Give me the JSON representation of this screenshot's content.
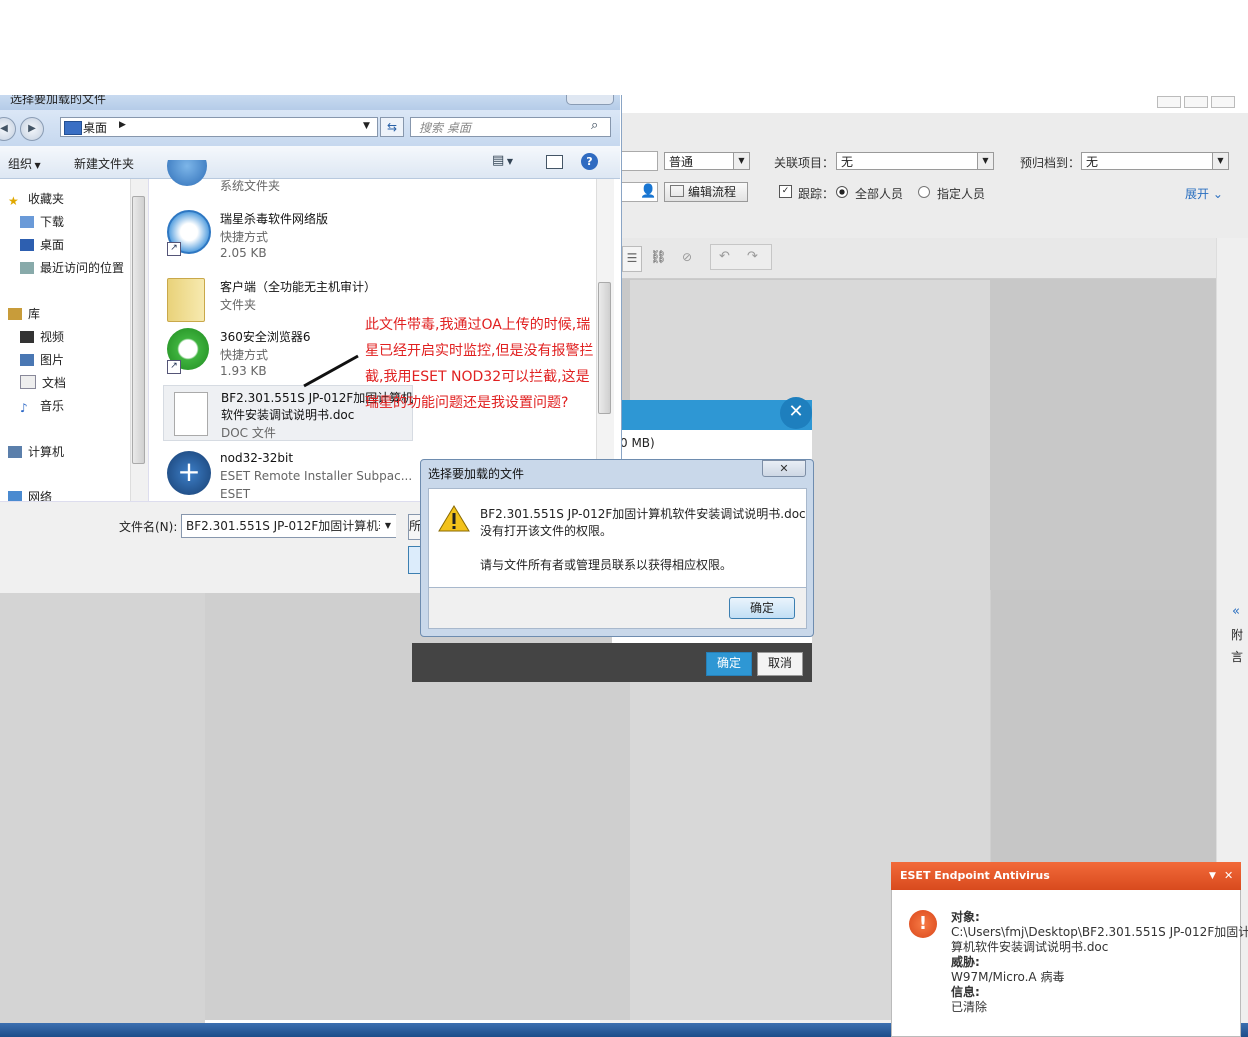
{
  "oa": {
    "priority_value": "普通",
    "related_label": "关联项目：",
    "related_value": "无",
    "archive_label": "预归档到：",
    "archive_value": "无",
    "flow_button": "编辑流程",
    "track_label": "跟踪：",
    "all_members": "全部人员",
    "specified_members": "指定人员",
    "expand": "展开",
    "side_text_1": "附",
    "side_text_2": "言"
  },
  "file_dialog": {
    "title": "选择要加载的文件",
    "address": "桌面",
    "search_placeholder": "搜索 桌面",
    "organize": "组织",
    "new_folder": "新建文件夹",
    "nav": {
      "favorites": "收藏夹",
      "downloads": "下载",
      "desktop": "桌面",
      "recent": "最近访问的位置",
      "library": "库",
      "videos": "视频",
      "pictures": "图片",
      "documents": "文档",
      "music": "音乐",
      "computer": "计算机",
      "network": "网络"
    },
    "files": [
      {
        "name": "",
        "type": "系统文件夹",
        "size": ""
      },
      {
        "name": "瑞星杀毒软件网络版",
        "type": "快捷方式",
        "size": "2.05 KB"
      },
      {
        "name": "客户端（全功能无主机审计）",
        "type": "文件夹",
        "size": ""
      },
      {
        "name": "360安全浏览器6",
        "type": "快捷方式",
        "size": "1.93 KB"
      },
      {
        "name": "BF2.301.551S JP-012F加固计算机",
        "name2": "软件安装调试说明书.doc",
        "type": "DOC 文件",
        "size": ""
      },
      {
        "name": "nod32-32bit",
        "type": "ESET Remote Installer Subpac...",
        "size": "ESET"
      }
    ],
    "filename_label": "文件名(N):",
    "filename_value": "BF2.301.551S JP-012F加固计算机软",
    "open_short": "所"
  },
  "annotation": "此文件带毒,我通过OA上传的时候,瑞星已经开启实时监控,但是没有报警拦截,我用ESET NOD32可以拦截,这是瑞星的功能问题还是我设置问题?",
  "upload_dialog": {
    "size_text": "0 MB)",
    "close": "✕",
    "confirm": "确定",
    "cancel": "取消"
  },
  "error_dialog": {
    "title": "选择要加载的文件",
    "line1": "BF2.301.551S JP-012F加固计算机软件安装调试说明书.doc",
    "line2": "没有打开该文件的权限。",
    "line3": "请与文件所有者或管理员联系以获得相应权限。",
    "ok": "确定"
  },
  "eset": {
    "title": "ESET Endpoint Antivirus",
    "object_label": "对象:",
    "object_value_1": "C:\\Users\\fmj\\Desktop\\BF2.301.551S JP-012F加固计",
    "object_value_2": "算机软件安装调试说明书.doc",
    "threat_label": "威胁:",
    "threat_value": "W97M/Micro.A 病毒",
    "info_label": "信息:",
    "info_value": "已清除"
  },
  "colors": {
    "annotation": "#e02020",
    "eset_header": "#e0562a",
    "dialog_blue": "#2e97d4"
  }
}
